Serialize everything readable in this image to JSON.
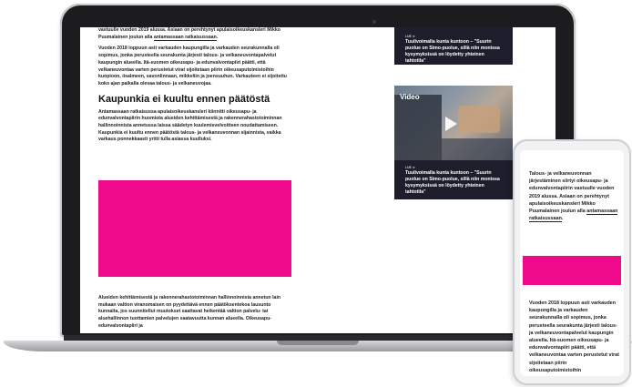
{
  "article": {
    "intro": {
      "before": "vastuulle vuoden 2019 alussa. Asiaan on perehtynyt apulaisoikeuskansleri ",
      "name": "Mikko Puumalainen",
      "middle": " joulun alla ",
      "link": "antamassaan ratkaisussaan",
      "after": "."
    },
    "paragraph2": "Vuoden 2018 loppuun asti varkauden kaupungilla ja varkauden seurakunnalla oli sopimus, jonka perusteella seurakunta järjesti talous- ja velkaneuvontapalvelut kaupungin alueella. Itä-suomen oikeusapu- ja edunvalvontapiiri päätti, että velkaneuvontaa varten perustetut virat sijoitetaan piirin oikeusaputoimistoihin kuopioon, iisalmeen, savonlinnaan, mikkeliin ja joensuuhun. Varkauteen ei sijoitettu koko ajan paikalla olevaa talous- ja velkaneuvojaa.",
    "heading": "Kaupunkia ei kuultu ennen päätöstä",
    "paragraph3": "Antamassaan ratkaisussa apulaisoikeuskansleri kiinnitti oikeusapu- ja edunvalvontapiirin huomiota alueiden kehittämisestä ja rakennerahastotoiminnan hallinnoinnista annetussa laissa säädetyn kuulemisvelvoitteen noudattamiseen. Kaupunkia ei kuultu ennen päätöstä talous- ja velkaneuvonnan sijainnista, vaikka varkaus ponnekkaasti yritti tulla asiassa kuulluksi.",
    "paragraph4": "Alueiden kehittämisestä ja rakennerahastotoiminnan hallinnoinnista annetun lain mukaan valtion viranomaisen on pyydettävä ennen päätöksentekoa lausunto kunnalta, jos suunnitellut muutokset saattavat heikentää valtion palvelu- tai aluehallinnon tuottamien palvelujen saatavuutta kunnan alueella. Oikeusapu- edunvalvontapiiri ja"
  },
  "sidebar": {
    "card1": {
      "meta": "LUE ➜",
      "title": "Tuulivoimalla kunta kuntoon – \"Suurin puolue on Simo-puolue, sillä niin monissa kysymyksissä on löydetty yhteinen tahtotila\""
    },
    "card2": {
      "video_label": "Video",
      "meta": "LUE ➜",
      "title": "Tuulivoimalla kunta kuntoon – \"Suurin puolue on Simo-puolue, sillä niin monissa kysymyksissä on löydetty yhteinen tahtotila\""
    }
  },
  "phone": {
    "intro": {
      "before": "Talous- ja velkaneuvonnan järjestäminen siirtyi oikeusapu- ja edunvalvontapiirin vastuulle vuoden 2019 alussa. Asiaan on perehtynyt apulaisoikeuskansleri ",
      "name": "Mikko Puumalainen",
      "middle": " joulun alla ",
      "link": "antamassaan ratkaisussaan",
      "after": "."
    },
    "paragraph2": "Vuoden 2018 loppuun asti varkauden kaupungilla ja varkauden seurakunnalla oli sopimus, jonka perusteella seurakunta järjesti talous- ja velkaneuvontapalvelut kaupungin alueella. Itä-suomen oikeusapu- ja edunvalvontapiiri päätti, että velkaneuvontaa varten perustetut virat sijoitetaan piirin oikeusaputoimistoihin"
  },
  "colors": {
    "ad_placeholder": "#ee0a8a",
    "card_background": "#1d1d2b",
    "text": "#222222"
  },
  "icons": {
    "video_play": "play-icon"
  }
}
